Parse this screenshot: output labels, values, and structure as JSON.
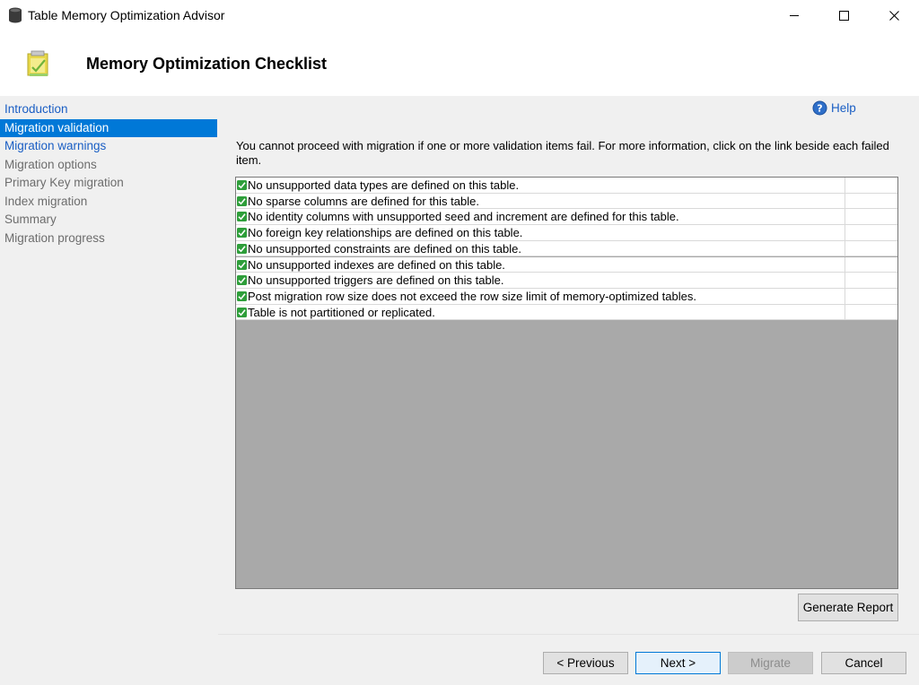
{
  "window": {
    "title": "Table Memory Optimization Advisor"
  },
  "header": {
    "title": "Memory Optimization Checklist"
  },
  "sidebar": {
    "items": [
      {
        "label": "Introduction",
        "state": "link"
      },
      {
        "label": "Migration validation",
        "state": "active"
      },
      {
        "label": "Migration warnings",
        "state": "link"
      },
      {
        "label": "Migration options",
        "state": "disabled"
      },
      {
        "label": "Primary Key migration",
        "state": "disabled"
      },
      {
        "label": "Index migration",
        "state": "disabled"
      },
      {
        "label": "Summary",
        "state": "disabled"
      },
      {
        "label": "Migration progress",
        "state": "disabled"
      }
    ]
  },
  "content": {
    "help_label": "Help",
    "info_text": "You cannot proceed with migration if one or more validation items fail. For more information, click on the link beside each failed item.",
    "checklist": [
      "No unsupported data types are defined on this table.",
      "No sparse columns are defined for this table.",
      "No identity columns with unsupported seed and increment are defined for this table.",
      "No foreign key relationships are defined on this table.",
      "No unsupported constraints are defined on this table.",
      "No unsupported indexes are defined on this table.",
      "No unsupported triggers are defined on this table.",
      "Post migration row size does not exceed the row size limit of memory-optimized tables.",
      "Table is not partitioned or replicated."
    ],
    "generate_report_label": "Generate Report"
  },
  "footer": {
    "previous_label": "< Previous",
    "next_label": "Next >",
    "migrate_label": "Migrate",
    "cancel_label": "Cancel"
  },
  "colors": {
    "accent": "#0078d7",
    "link": "#1a5ec4",
    "check_green": "#2e9e3a"
  }
}
